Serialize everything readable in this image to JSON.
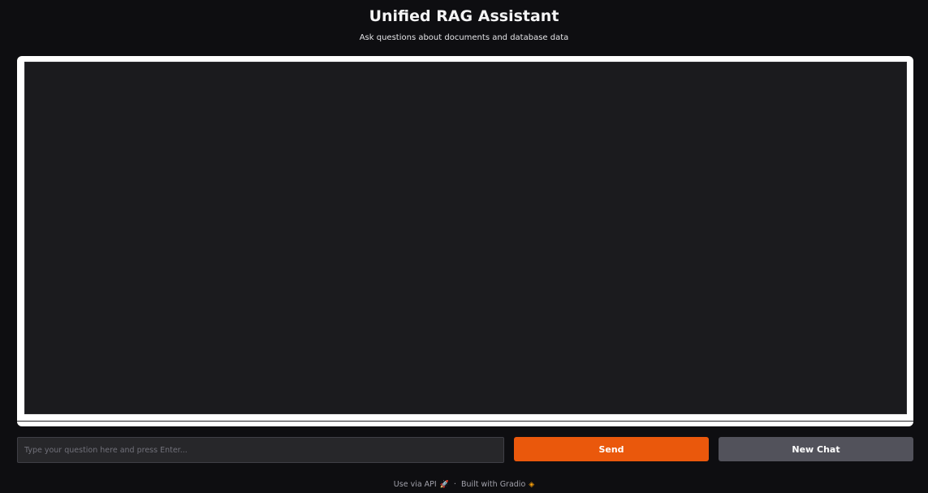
{
  "header": {
    "title": "Unified RAG Assistant",
    "subtitle": "Ask questions about documents and database data"
  },
  "chat": {
    "messages": []
  },
  "input": {
    "value": "",
    "placeholder": "Type your question here and press Enter..."
  },
  "buttons": {
    "send_label": "Send",
    "new_chat_label": "New Chat"
  },
  "footer": {
    "api_label": "Use via API",
    "api_icon": "rocket-icon",
    "separator": "·",
    "built_label": "Built with Gradio",
    "built_icon": "gradio-logo-icon"
  },
  "colors": {
    "background": "#0e0e11",
    "accent": "#ea580c",
    "secondary_button": "#52525b",
    "chat_panel": "#1b1b1e"
  }
}
